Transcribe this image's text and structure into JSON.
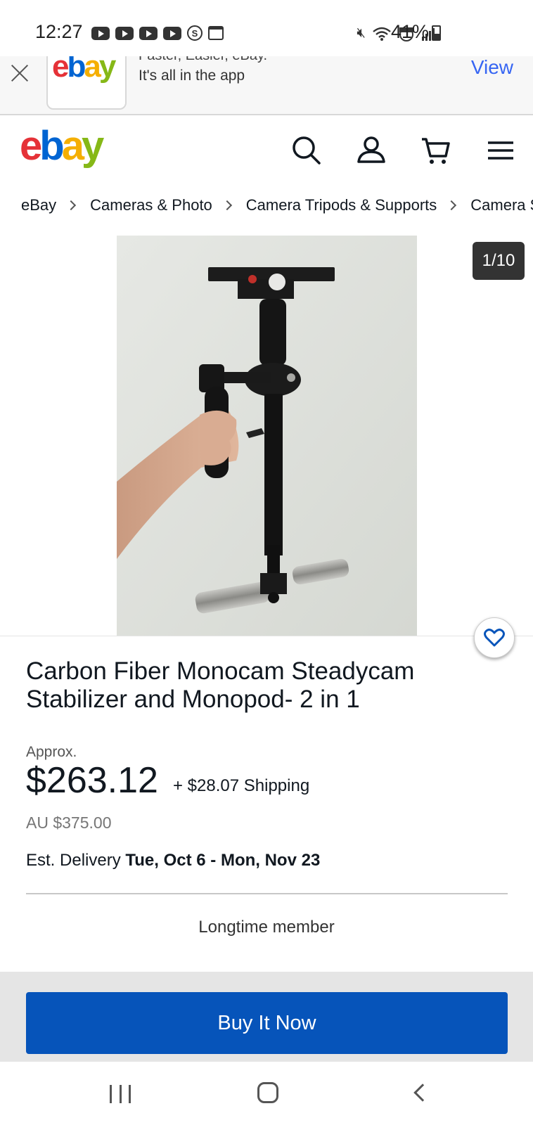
{
  "status_bar": {
    "time": "12:27",
    "battery": "41%"
  },
  "app_banner": {
    "logo": [
      "e",
      "b",
      "a",
      "y"
    ],
    "line1": "Faster, Easier, eBay.",
    "line2": "It's all in the app",
    "action": "View"
  },
  "header": {
    "logo": [
      "e",
      "b",
      "a",
      "y"
    ],
    "icons": [
      "search-icon",
      "user-icon",
      "cart-icon",
      "menu-icon"
    ]
  },
  "breadcrumb": [
    "eBay",
    "Cameras & Photo",
    "Camera Tripods & Supports",
    "Camera Stabilizers"
  ],
  "gallery": {
    "counter": "1/10"
  },
  "item": {
    "title": "Carbon Fiber Monocam Steadycam Stabilizer and Monopod- 2 in 1",
    "approx_label": "Approx.",
    "price": "$263.12",
    "shipping": "+ $28.07 Shipping",
    "original_price": "AU $375.00",
    "delivery_label": "Est. Delivery",
    "delivery_dates": "Tue, Oct 6 - Mon, Nov 23",
    "seller_note": "Longtime member"
  },
  "buy_button": "Buy It Now",
  "colors": {
    "accent": "#3665f3",
    "buy_button": "#0654ba"
  }
}
